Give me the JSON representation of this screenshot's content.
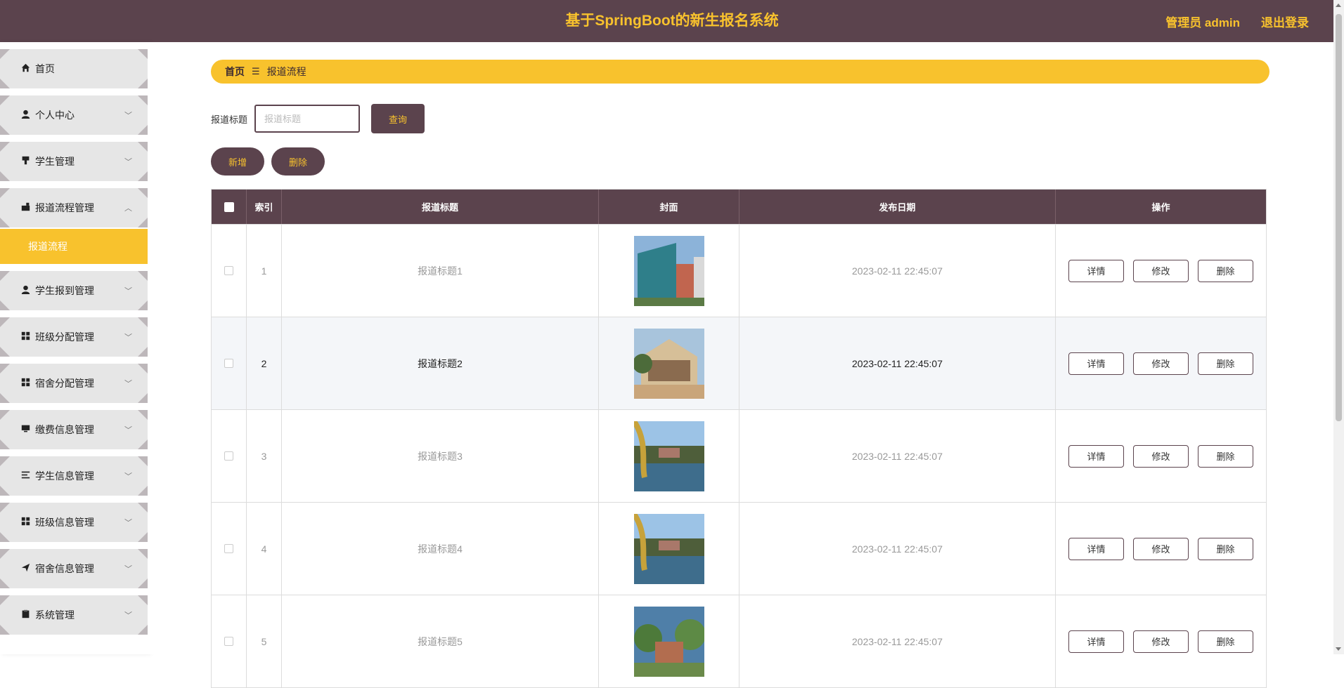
{
  "header": {
    "title": "基于SpringBoot的新生报名系统",
    "admin": "管理员 admin",
    "logout": "退出登录"
  },
  "sidebar": {
    "items": [
      {
        "label": "首页",
        "icon": "home-icon"
      },
      {
        "label": "个人中心",
        "icon": "user-icon"
      },
      {
        "label": "学生管理",
        "icon": "stamp-icon"
      },
      {
        "label": "报道流程管理",
        "icon": "bank-icon"
      },
      {
        "label": "学生报到管理",
        "icon": "user-icon"
      },
      {
        "label": "班级分配管理",
        "icon": "grid-icon"
      },
      {
        "label": "宿舍分配管理",
        "icon": "grid-icon"
      },
      {
        "label": "缴费信息管理",
        "icon": "monitor-icon"
      },
      {
        "label": "学生信息管理",
        "icon": "list-icon"
      },
      {
        "label": "班级信息管理",
        "icon": "grid-icon"
      },
      {
        "label": "宿舍信息管理",
        "icon": "paper-plane-icon"
      },
      {
        "label": "系统管理",
        "icon": "clipboard-icon"
      }
    ],
    "active_sub": "报道流程"
  },
  "breadcrumb": {
    "home": "首页",
    "sep": "☰",
    "current": "报道流程"
  },
  "search": {
    "label": "报道标题",
    "placeholder": "报道标题",
    "button": "查询"
  },
  "actions": {
    "add": "新增",
    "delete": "删除"
  },
  "table": {
    "headers": {
      "index": "索引",
      "title": "报道标题",
      "cover": "封面",
      "date": "发布日期",
      "ops": "操作"
    },
    "ops": {
      "detail": "详情",
      "edit": "修改",
      "delete": "删除"
    },
    "rows": [
      {
        "index": "1",
        "title": "报道标题1",
        "date": "2023-02-11 22:45:07"
      },
      {
        "index": "2",
        "title": "报道标题2",
        "date": "2023-02-11 22:45:07"
      },
      {
        "index": "3",
        "title": "报道标题3",
        "date": "2023-02-11 22:45:07"
      },
      {
        "index": "4",
        "title": "报道标题4",
        "date": "2023-02-11 22:45:07"
      },
      {
        "index": "5",
        "title": "报道标题5",
        "date": "2023-02-11 22:45:07"
      }
    ]
  },
  "colors": {
    "primary": "#5b434d",
    "accent": "#f8c22d"
  }
}
